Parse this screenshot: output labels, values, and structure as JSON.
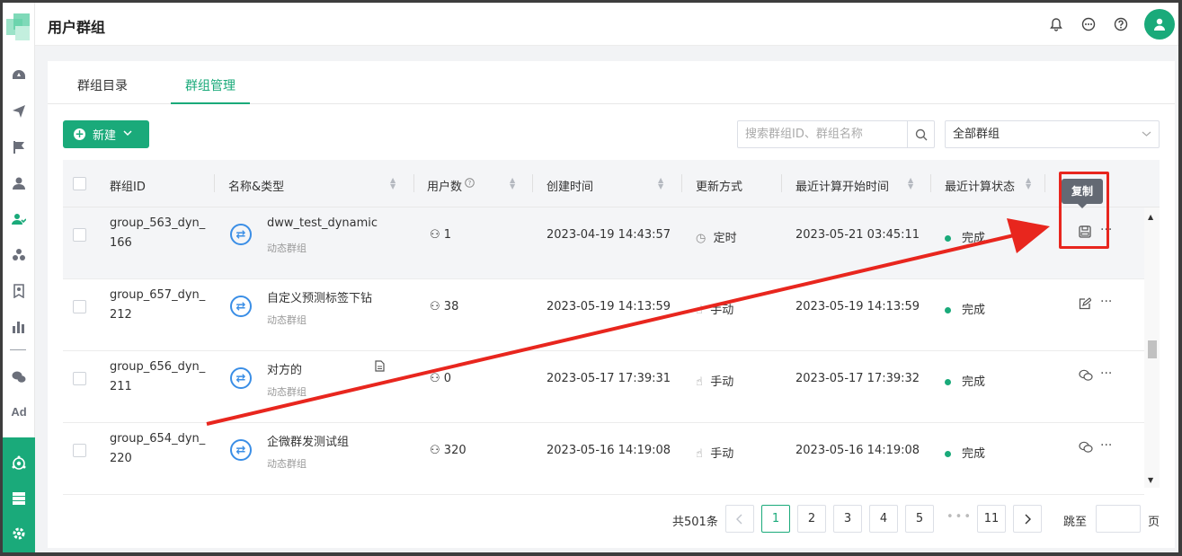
{
  "header": {
    "title": "用户群组"
  },
  "sidebar": {
    "ad_label": "Ad"
  },
  "tabs": [
    {
      "label": "群组目录"
    },
    {
      "label": "群组管理",
      "active": true
    }
  ],
  "toolbar": {
    "new_label": "新建",
    "search_placeholder": "搜索群组ID、群组名称",
    "filter_value": "全部群组"
  },
  "table": {
    "columns": [
      "群组ID",
      "名称&类型",
      "用户数",
      "创建时间",
      "更新方式",
      "最近计算开始时间",
      "最近计算状态"
    ],
    "rows": [
      {
        "id_line1": "group_563_dyn_",
        "id_line2": "166",
        "name": "dww_test_dynamic",
        "type": "动态群组",
        "users": "1",
        "created": "2023-04-19 14:43:57",
        "update": "定时",
        "last_start": "2023-05-21 03:45:11",
        "status": "完成"
      },
      {
        "id_line1": "group_657_dyn_",
        "id_line2": "212",
        "name": "自定义预测标签下钻",
        "type": "动态群组",
        "users": "38",
        "created": "2023-05-19 14:13:59",
        "update": "手动",
        "last_start": "2023-05-19 14:13:59",
        "status": "完成"
      },
      {
        "id_line1": "group_656_dyn_",
        "id_line2": "211",
        "name": "对方的",
        "type": "动态群组",
        "users": "0",
        "created": "2023-05-17 17:39:31",
        "update": "手动",
        "last_start": "2023-05-17 17:39:32",
        "status": "完成"
      },
      {
        "id_line1": "group_654_dyn_",
        "id_line2": "220",
        "name": "企微群发测试组",
        "type": "动态群组",
        "users": "320",
        "created": "2023-05-16 14:19:08",
        "update": "手动",
        "last_start": "2023-05-16 14:19:08",
        "status": "完成"
      }
    ]
  },
  "pagination": {
    "total": "共501条",
    "pages": [
      "1",
      "2",
      "3",
      "4",
      "5",
      "11"
    ],
    "current": "1",
    "jump_label": "跳至",
    "jump_unit": "页"
  },
  "annotation": {
    "tooltip": "复制"
  },
  "colors": {
    "accent": "#1aaa7a",
    "link_blue": "#3a8ee6",
    "annotation_red": "#e8261e"
  }
}
